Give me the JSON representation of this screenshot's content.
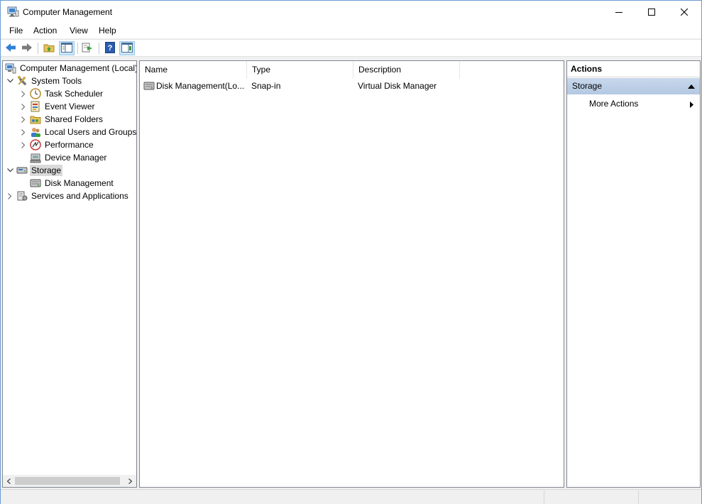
{
  "window": {
    "title": "Computer Management"
  },
  "menu": {
    "items": [
      "File",
      "Action",
      "View",
      "Help"
    ]
  },
  "toolbar": {
    "buttons": [
      "back-icon",
      "forward-icon",
      "up-folder-icon",
      "show-hide-tree-icon",
      "export-list-icon",
      "help-icon",
      "show-hide-action-pane-icon"
    ]
  },
  "tree": {
    "root": "Computer Management (Local)",
    "system_tools": "System Tools",
    "task_scheduler": "Task Scheduler",
    "event_viewer": "Event Viewer",
    "shared_folders": "Shared Folders",
    "local_users": "Local Users and Groups",
    "performance": "Performance",
    "device_manager": "Device Manager",
    "storage": "Storage",
    "disk_management": "Disk Management",
    "services": "Services and Applications"
  },
  "list": {
    "columns": [
      "Name",
      "Type",
      "Description"
    ],
    "rows": [
      {
        "name": "Disk Management(Lo...",
        "type": "Snap-in",
        "description": "Virtual Disk Manager"
      }
    ]
  },
  "actions": {
    "header": "Actions",
    "group": "Storage",
    "more_actions": "More Actions"
  }
}
